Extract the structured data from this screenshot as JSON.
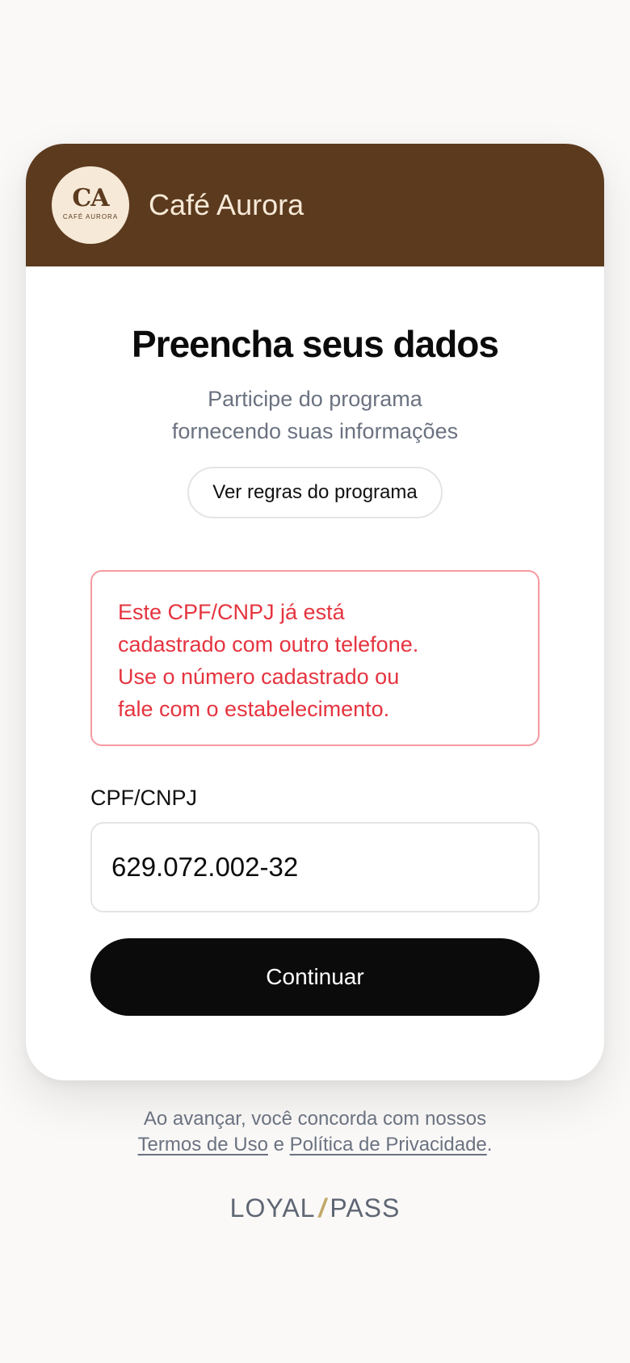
{
  "brand": {
    "logo_initials": "CA",
    "logo_subtext": "CAFÉ AURORA",
    "name": "Café Aurora",
    "header_color": "#5c3a1e"
  },
  "form": {
    "title": "Preencha seus dados",
    "subtitle_lines": [
      "Participe do programa",
      "fornecendo suas informações"
    ],
    "rules_button_label": "Ver regras do programa",
    "error_lines": [
      "Este CPF/CNPJ já está",
      "cadastrado com outro telefone.",
      "Use o número cadastrado ou",
      "fale com o estabelecimento."
    ],
    "error_color": "#e5343f",
    "cpf_label": "CPF/CNPJ",
    "cpf_value": "629.072.002-32",
    "continue_label": "Continuar"
  },
  "legal": {
    "line1": "Ao avançar, você concorda com nossos",
    "terms_link": "Termos de Uso",
    "conjunction": "e",
    "privacy_link": "Política de Privacidade",
    "period": "."
  },
  "footer": {
    "logo_left": "LOYAL",
    "logo_slash": "/",
    "logo_right": "PASS"
  }
}
